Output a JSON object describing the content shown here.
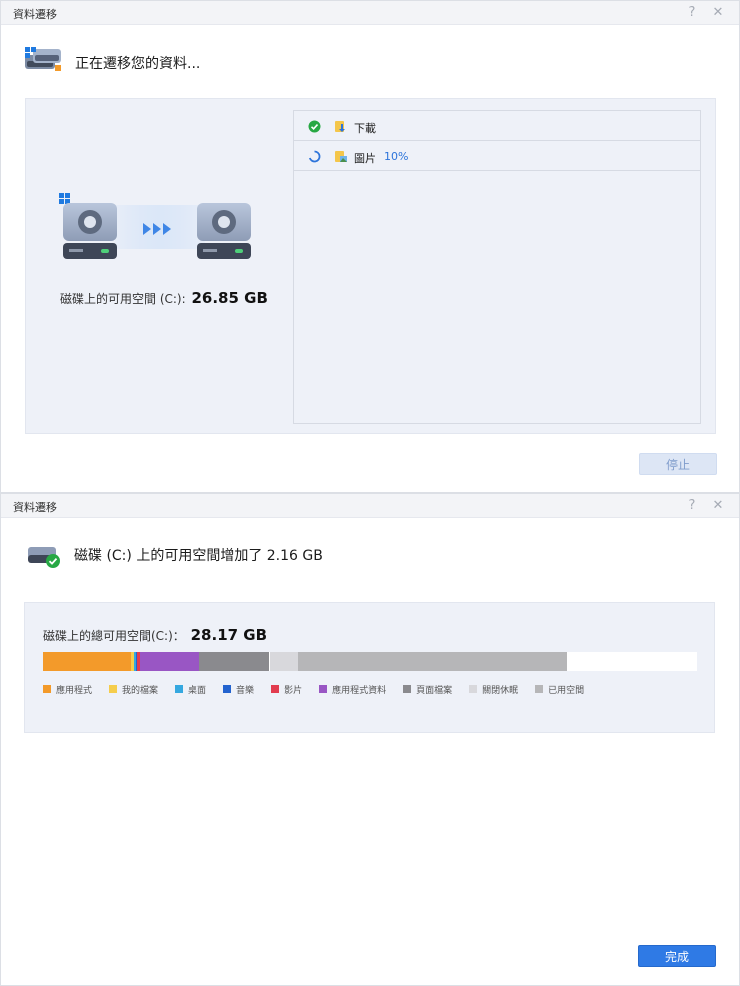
{
  "window1": {
    "title": "資料遷移",
    "heading": "正在遷移您的資料...",
    "items": [
      {
        "name": "下載",
        "status": "done-icon",
        "progress": ""
      },
      {
        "name": "圖片",
        "status": "spinner-icon",
        "progress": "10%"
      }
    ],
    "free_space_label": "磁碟上的可用空間 (C:):",
    "free_space_value": "26.85 GB",
    "stop_label": "停止"
  },
  "window2": {
    "title": "資料遷移",
    "heading": "磁碟 (C:) 上的可用空間增加了 2.16 GB",
    "total_label": "磁碟上的總可用空間(C:)：",
    "total_value": "28.17 GB",
    "usage": [
      {
        "name": "應用程式",
        "color": "#f39a2a",
        "fraction": 0.135
      },
      {
        "name": "我的檔案",
        "color": "#f5cd4c",
        "fraction": 0.005
      },
      {
        "name": "桌面",
        "color": "#35a8e0",
        "fraction": 0.003
      },
      {
        "name": "音樂",
        "color": "#2363cf",
        "fraction": 0.002
      },
      {
        "name": "影片",
        "color": "#e23c4f",
        "fraction": 0.005
      },
      {
        "name": "應用程式資料",
        "color": "#9956c4",
        "fraction": 0.09
      },
      {
        "name": "頁面檔案",
        "color": "#8a8a8e",
        "fraction": 0.107
      },
      {
        "name": "關閉休眠",
        "color": "#d8d8dc",
        "fraction": 0.043
      },
      {
        "name": "已用空間",
        "color": "#b6b6b8",
        "fraction": 0.412
      }
    ],
    "done_label": "完成"
  },
  "icons": {
    "help": "?",
    "close": "✕"
  }
}
